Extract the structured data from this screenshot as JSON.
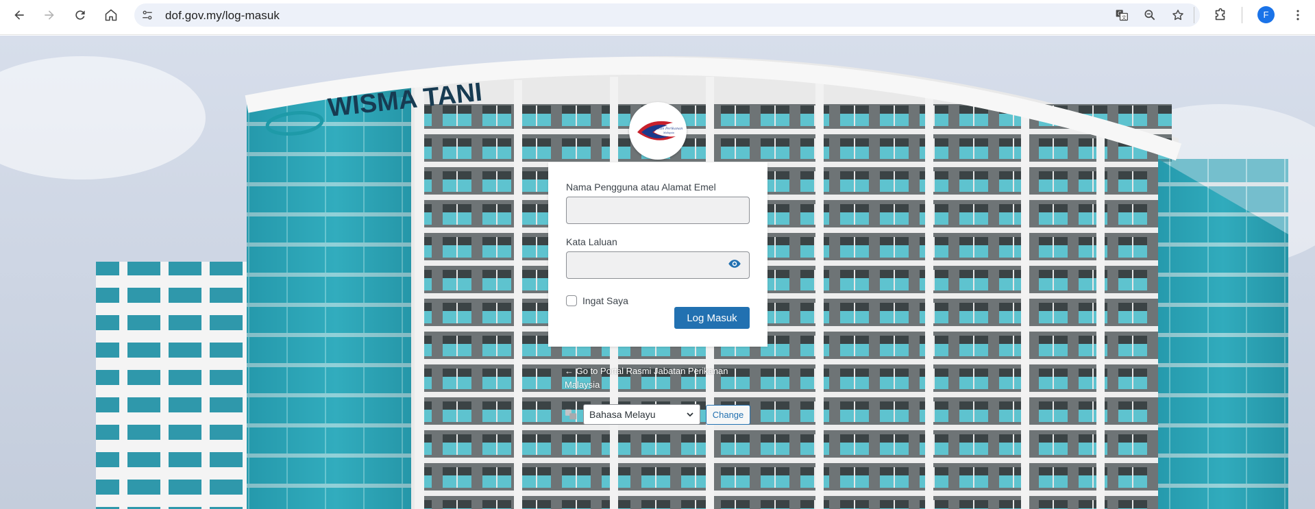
{
  "browser": {
    "url": "dof.gov.my/log-masuk",
    "profile_initial": "F",
    "icons": {
      "back": "arrow-left-icon",
      "forward": "arrow-right-icon",
      "reload": "reload-icon",
      "home": "home-icon",
      "site_info": "tune-icon",
      "translate": "translate-icon",
      "zoom": "zoom-icon",
      "bookmark": "star-icon",
      "extensions": "puzzle-icon",
      "menu": "kebab-menu-icon"
    }
  },
  "background": {
    "building_sign": "WISMA TANI"
  },
  "logo": {
    "text": "Jabatan Perikanan Malaysia"
  },
  "login": {
    "username_label": "Nama Pengguna atau Alamat Emel",
    "username_value": "",
    "password_label": "Kata Laluan",
    "password_value": "",
    "remember_label": "Ingat Saya",
    "remember_checked": false,
    "submit_label": "Log Masuk"
  },
  "backlink": {
    "text": "← Go to Portal Rasmi Jabatan Perikanan Malaysia"
  },
  "language": {
    "selected": "Bahasa Melayu",
    "change_label": "Change"
  },
  "colors": {
    "primary": "#2271b1",
    "profile": "#1a73e8"
  }
}
